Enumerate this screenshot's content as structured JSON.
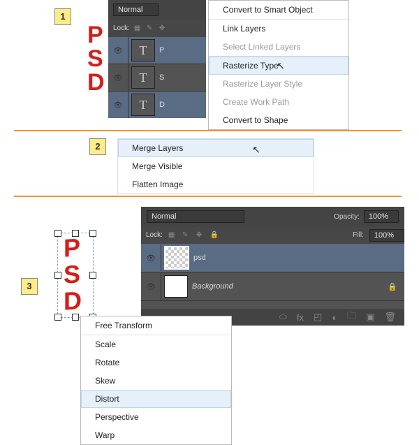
{
  "step1": {
    "badge": "1",
    "psd_logo": "P\nS\nD",
    "palette": {
      "blend_mode": "Normal",
      "lock_label": "Lock:",
      "layers": [
        {
          "thumb": "T",
          "name": "P",
          "eye": true,
          "selected": true
        },
        {
          "thumb": "T",
          "name": "S",
          "eye": true,
          "selected": false
        },
        {
          "thumb": "T",
          "name": "D",
          "eye": true,
          "selected": true
        }
      ]
    },
    "menu": [
      {
        "label": "Convert to Smart Object",
        "enabled": true
      },
      {
        "label": "Link Layers",
        "enabled": true
      },
      {
        "label": "Select Linked Layers",
        "enabled": false
      },
      {
        "label": "Rasterize Type",
        "enabled": true,
        "highlight": true
      },
      {
        "label": "Rasterize Layer Style",
        "enabled": false
      },
      {
        "label": "Create Work Path",
        "enabled": false
      },
      {
        "label": "Convert to Shape",
        "enabled": true
      }
    ]
  },
  "step2": {
    "badge": "2",
    "menu": [
      {
        "label": "Merge Layers",
        "highlight": true
      },
      {
        "label": "Merge Visible"
      },
      {
        "label": "Flatten Image"
      }
    ]
  },
  "step3": {
    "badge": "3",
    "psd_logo": "P\nS\nD",
    "palette": {
      "blend_mode": "Normal",
      "opacity_label": "Opacity:",
      "opacity_value": "100%",
      "fill_label": "Fill:",
      "fill_value": "100%",
      "lock_label": "Lock:",
      "layers": [
        {
          "name": "psd",
          "selected": true,
          "thumb": "checker"
        },
        {
          "name": "Background",
          "italic": true,
          "locked": true,
          "thumb": "white"
        }
      ]
    },
    "menu": [
      {
        "label": "Free Transform"
      },
      {
        "label": "Scale"
      },
      {
        "label": "Rotate"
      },
      {
        "label": "Skew"
      },
      {
        "label": "Distort",
        "highlight": true
      },
      {
        "label": "Perspective"
      },
      {
        "label": "Warp"
      }
    ]
  }
}
